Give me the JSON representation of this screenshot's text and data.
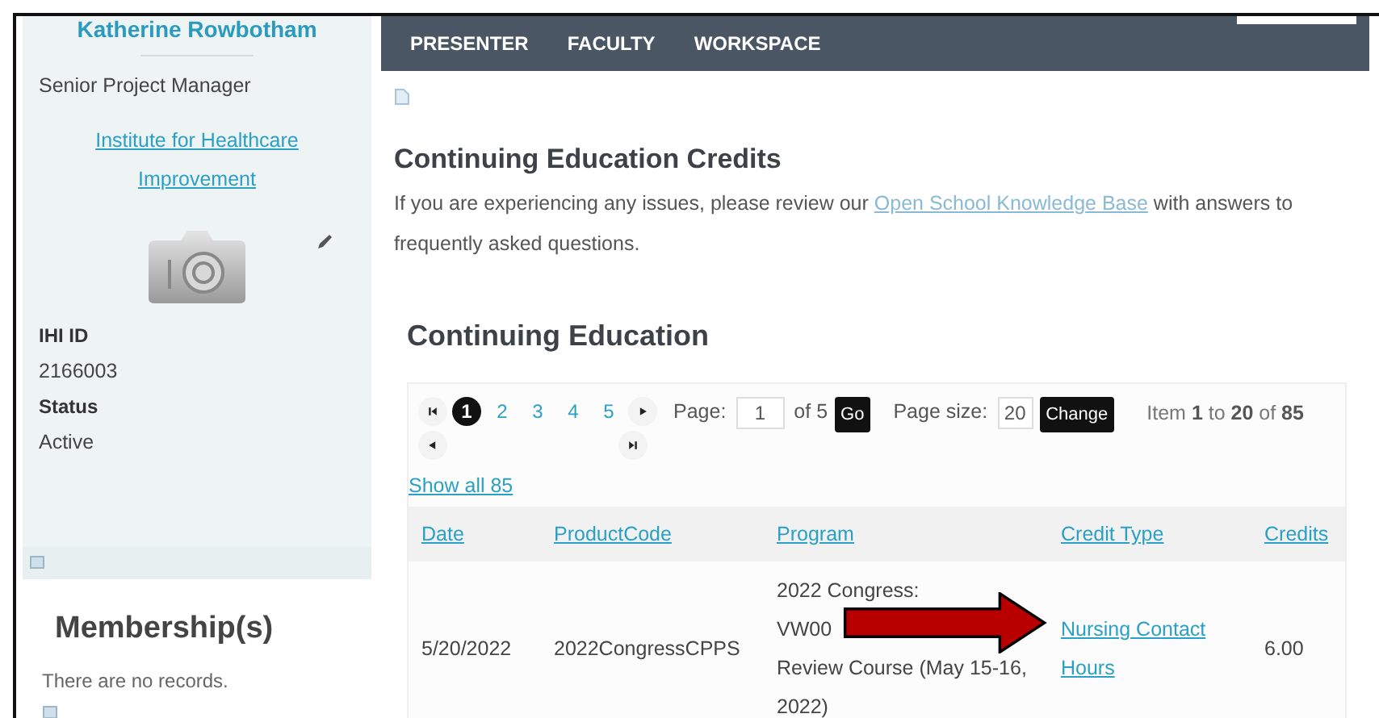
{
  "profile": {
    "name": "Katherine Rowbotham",
    "title": "Senior Project Manager",
    "organization": "Institute for Healthcare Improvement",
    "fields": [
      {
        "label": "IHI ID",
        "value": "2166003"
      },
      {
        "label": "Status",
        "value": "Active"
      }
    ]
  },
  "membership": {
    "heading": "Membership(s)",
    "empty_text": "There are no records."
  },
  "nav": {
    "items": [
      {
        "label": "PRESENTER"
      },
      {
        "label": "FACULTY"
      },
      {
        "label": "WORKSPACE"
      }
    ]
  },
  "page": {
    "title": "Continuing Education Credits",
    "intro_before": "If you are experiencing any issues, please review our",
    "intro_link": "Open School Knowledge Base",
    "intro_after": "with answers to frequently asked questions."
  },
  "section": {
    "title": "Continuing Education",
    "pager": {
      "pages": [
        {
          "label": "1",
          "selected": true
        },
        {
          "label": "2",
          "selected": false
        },
        {
          "label": "3",
          "selected": false
        },
        {
          "label": "4",
          "selected": false
        },
        {
          "label": "5",
          "selected": false
        }
      ],
      "page_label": "Page:",
      "page_value": "1",
      "page_of": "of 5",
      "go": "Go",
      "size_label": "Page size:",
      "size_value": "20",
      "change": "Change",
      "summary": "Item **1** to **20** of **85**"
    },
    "show_all": "Show all 85",
    "table": {
      "columns": [
        "Date",
        "ProductCode",
        "Program",
        "Credit Type",
        "Credits"
      ],
      "rows": [
        {
          "date": "5/20/2022",
          "product_code": "2022CongressCPPS",
          "program_lines": [
            "2022 Congress:",
            "VW00",
            "Review Course (May 15-16,",
            "2022)"
          ],
          "credit_type": "Nursing Contact Hours",
          "credits": "6.00"
        }
      ]
    }
  }
}
